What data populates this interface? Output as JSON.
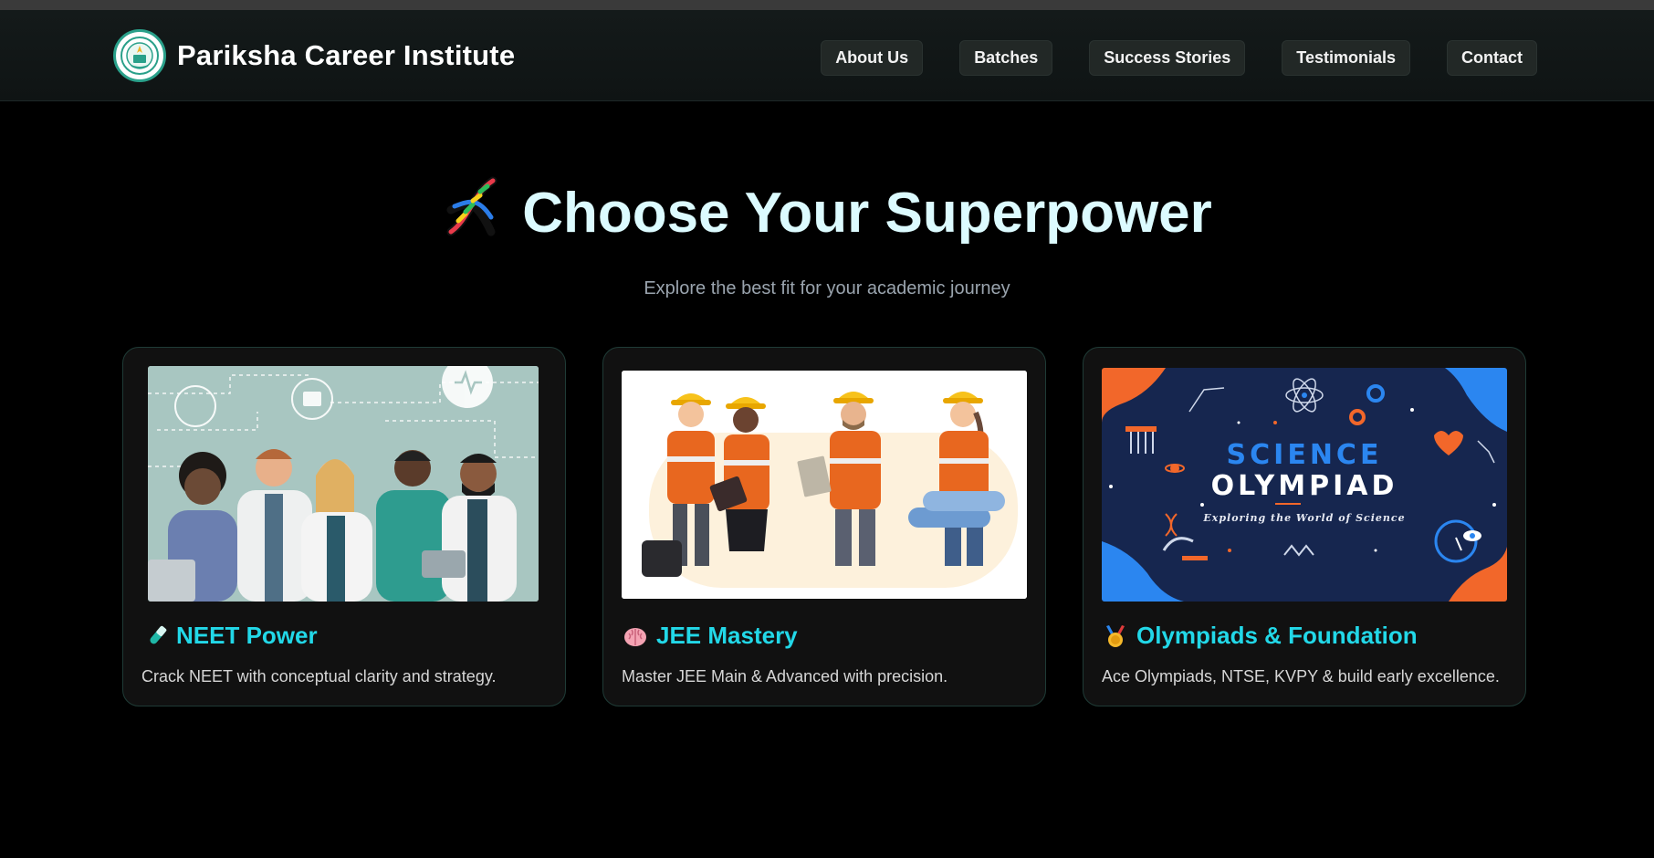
{
  "header": {
    "brand": "Pariksha Career Institute",
    "nav": [
      "About Us",
      "Batches",
      "Success Stories",
      "Testimonials",
      "Contact"
    ]
  },
  "hero": {
    "icon": "dna-icon",
    "title": "Choose Your Superpower",
    "subtitle": "Explore the best fit for your academic journey"
  },
  "cards": [
    {
      "icon": "test-tube-icon",
      "title": "NEET Power",
      "description": "Crack NEET with conceptual clarity and strategy."
    },
    {
      "icon": "brain-icon",
      "title": "JEE Mastery",
      "description": "Master JEE Main & Advanced with precision."
    },
    {
      "icon": "medal-icon",
      "title": "Olympiads & Foundation",
      "description": "Ace Olympiads, NTSE, KVPY & build early excellence."
    }
  ],
  "olympiad_image": {
    "title_line1": "SCIENCE",
    "title_line2": "OLYMPIAD",
    "tagline": "Exploring the World of Science"
  },
  "colors": {
    "accent": "#22d8e8",
    "hero_title": "#dcfbff",
    "background": "#000000"
  }
}
